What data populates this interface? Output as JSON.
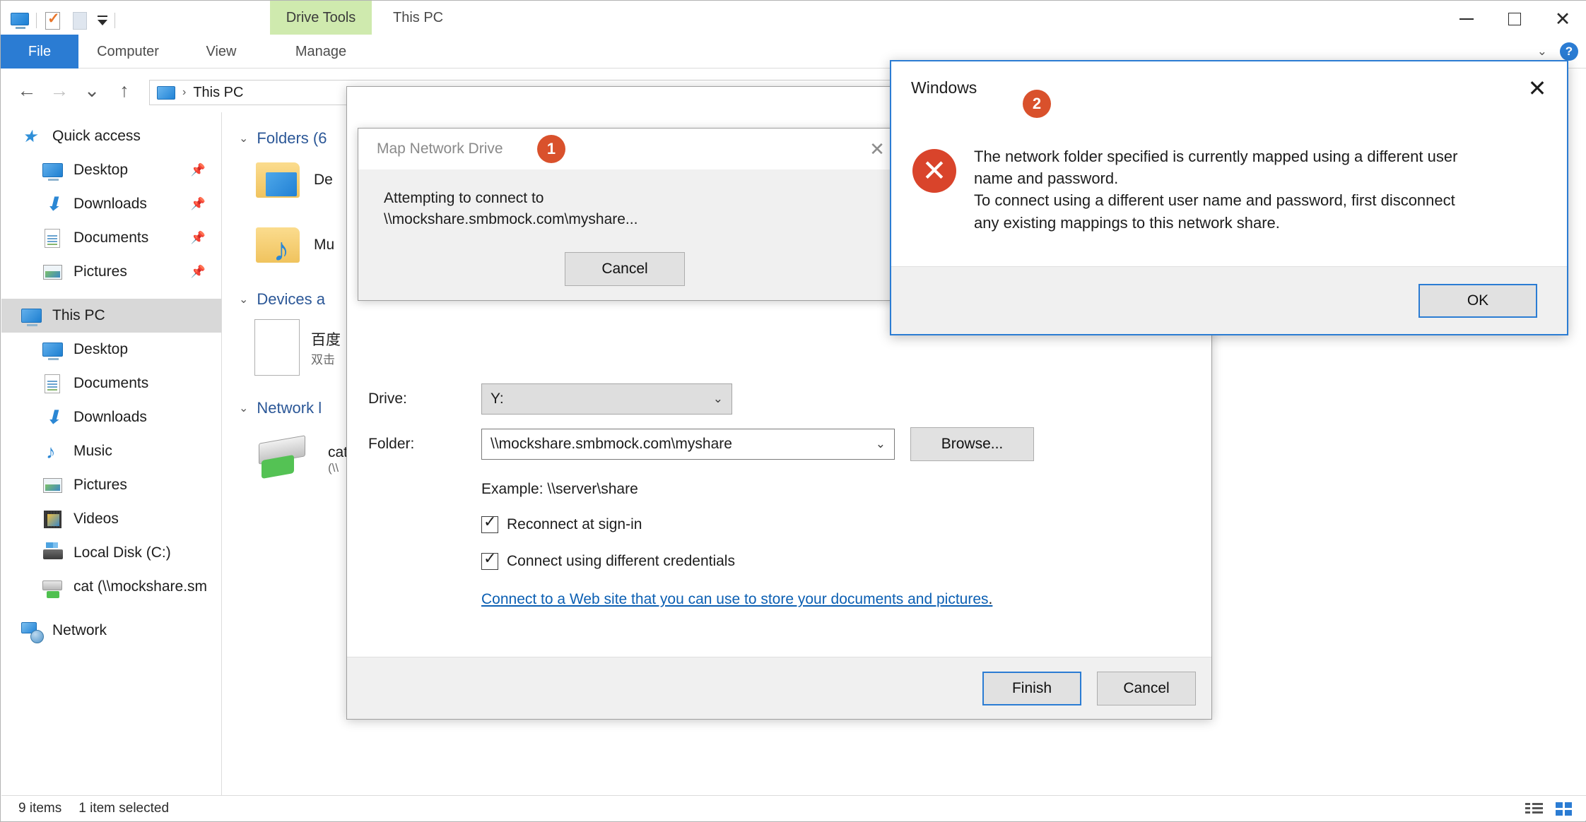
{
  "window": {
    "title": "This PC",
    "contextual_tab": "Drive Tools",
    "controls": {
      "minimize": "minimize-icon",
      "maximize": "maximize-icon",
      "close": "close-icon"
    }
  },
  "ribbon": {
    "tabs": [
      {
        "label": "File"
      },
      {
        "label": "Computer"
      },
      {
        "label": "View"
      },
      {
        "label": "Manage"
      }
    ],
    "help_label": "?",
    "collapse_label": "⌄"
  },
  "nav": {
    "back": "←",
    "forward": "→",
    "recent": "⌄",
    "up": "↑",
    "breadcrumb_root": "This PC",
    "breadcrumb_sep": "›"
  },
  "sidebar": {
    "items": [
      {
        "label": "Quick access",
        "icon": "star-icon",
        "level": 0,
        "selected": false,
        "pinned": false
      },
      {
        "label": "Desktop",
        "icon": "monitor-icon",
        "level": 1,
        "selected": false,
        "pinned": true
      },
      {
        "label": "Downloads",
        "icon": "download-icon",
        "level": 1,
        "selected": false,
        "pinned": true
      },
      {
        "label": "Documents",
        "icon": "document-icon",
        "level": 1,
        "selected": false,
        "pinned": true
      },
      {
        "label": "Pictures",
        "icon": "picture-icon",
        "level": 1,
        "selected": false,
        "pinned": true
      },
      {
        "label": "This PC",
        "icon": "monitor-icon",
        "level": 0,
        "selected": true,
        "pinned": false
      },
      {
        "label": "Desktop",
        "icon": "monitor-icon",
        "level": 1,
        "selected": false,
        "pinned": false
      },
      {
        "label": "Documents",
        "icon": "document-icon",
        "level": 1,
        "selected": false,
        "pinned": false
      },
      {
        "label": "Downloads",
        "icon": "download-icon",
        "level": 1,
        "selected": false,
        "pinned": false
      },
      {
        "label": "Music",
        "icon": "music-icon",
        "level": 1,
        "selected": false,
        "pinned": false
      },
      {
        "label": "Pictures",
        "icon": "picture-icon",
        "level": 1,
        "selected": false,
        "pinned": false
      },
      {
        "label": "Videos",
        "icon": "video-icon",
        "level": 1,
        "selected": false,
        "pinned": false
      },
      {
        "label": "Local Disk (C:)",
        "icon": "disk-icon",
        "level": 1,
        "selected": false,
        "pinned": false
      },
      {
        "label": "cat (\\\\mockshare.sm",
        "icon": "network-drive-icon",
        "level": 1,
        "selected": false,
        "pinned": false
      },
      {
        "label": "Network",
        "icon": "network-icon",
        "level": 0,
        "selected": false,
        "pinned": false
      }
    ]
  },
  "content": {
    "groups": [
      {
        "header": "Folders (6",
        "items": [
          {
            "name": "De",
            "sub": "",
            "icon": "folder-desktop-icon"
          },
          {
            "name": "Mu",
            "sub": "",
            "icon": "folder-music-icon"
          }
        ]
      },
      {
        "header": "Devices a",
        "items": [
          {
            "name": "百度",
            "sub": "双击",
            "icon": "document-icon"
          }
        ]
      },
      {
        "header": "Network l",
        "items": [
          {
            "name": "cat",
            "sub": "(\\\\",
            "icon": "network-drive-icon"
          }
        ]
      }
    ]
  },
  "statusbar": {
    "item_count": "9 items",
    "selection": "1 item selected",
    "view_details": "details-view-icon",
    "view_tiles": "tiles-view-icon"
  },
  "map_network_drive": {
    "fields": {
      "drive_label": "Drive:",
      "drive_value": "Y:",
      "folder_label": "Folder:",
      "folder_value": "\\\\mockshare.smbmock.com\\myshare",
      "browse_label": "Browse...",
      "example": "Example: \\\\server\\share"
    },
    "checkboxes": [
      {
        "label": "Reconnect at sign-in",
        "checked": true
      },
      {
        "label": "Connect using different credentials",
        "checked": true
      }
    ],
    "web_link": "Connect to a Web site that you can use to store your documents and pictures",
    "web_link_period": ".",
    "buttons": {
      "finish": "Finish",
      "cancel": "Cancel"
    }
  },
  "progress_dialog": {
    "title": "Map Network Drive",
    "badge": "1",
    "message_line1": "Attempting to connect to",
    "message_line2": "\\\\mockshare.smbmock.com\\myshare...",
    "cancel_label": "Cancel",
    "close_icon": "close-icon"
  },
  "error_dialog": {
    "title": "Windows",
    "badge": "2",
    "icon": "error-x-icon",
    "message_lines": [
      "The network folder specified is currently mapped using a different user",
      "name and password.",
      "To connect using a different user name and password, first disconnect",
      "any existing mappings to this network share."
    ],
    "ok_label": "OK",
    "close_icon": "close-icon"
  },
  "colors": {
    "accent_blue": "#2b7cd3",
    "badge_orange": "#d9512c",
    "error_red": "#d9442b",
    "contextual_green": "#cfeaae",
    "link_blue": "#0b5fb3"
  }
}
